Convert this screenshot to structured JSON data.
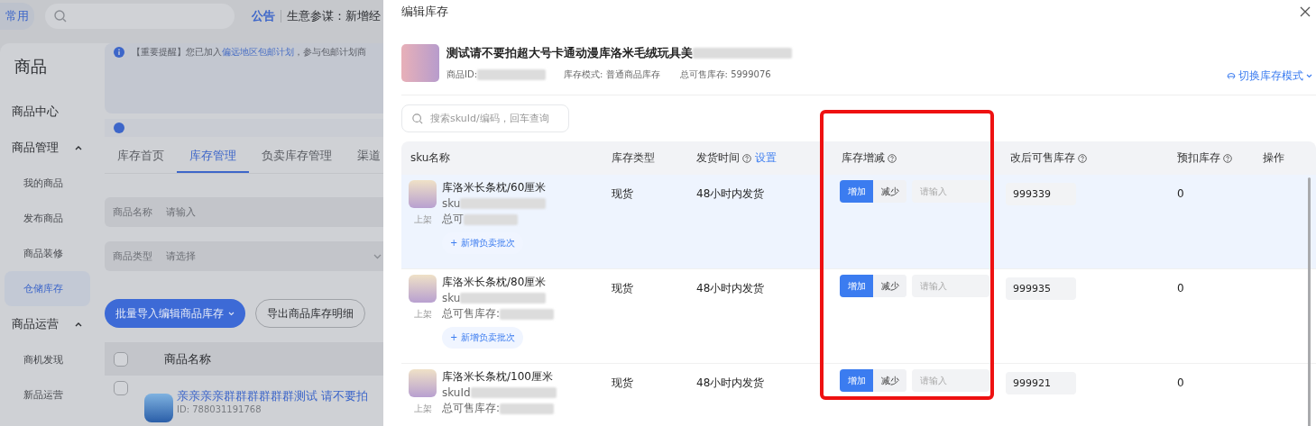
{
  "top_bar": {
    "shortcut": "常用",
    "notice_label": "公告",
    "notice_text": "生意参谋：新增经"
  },
  "sidebar": {
    "title": "商品",
    "items": [
      {
        "label": "商品中心",
        "kind": "link",
        "selected": false
      },
      {
        "label": "商品管理",
        "kind": "group",
        "expanded": true,
        "children": [
          {
            "label": "我的商品",
            "selected": false
          },
          {
            "label": "发布商品",
            "selected": false
          },
          {
            "label": "商品装修",
            "selected": false
          },
          {
            "label": "仓储库存",
            "selected": true
          }
        ]
      },
      {
        "label": "商品运营",
        "kind": "group",
        "expanded": true,
        "children": [
          {
            "label": "商机发现",
            "selected": false
          },
          {
            "label": "新品运营",
            "selected": false
          }
        ]
      }
    ]
  },
  "notices": [
    {
      "prefix": "【重要提醒】您已加入",
      "link": "偏远地区包邮计划",
      "suffix": "，参与包邮计划商"
    }
  ],
  "tabs": [
    {
      "label": "库存首页",
      "selected": false
    },
    {
      "label": "库存管理",
      "selected": true
    },
    {
      "label": "负卖库存管理",
      "selected": false
    },
    {
      "label": "渠道",
      "selected": false
    }
  ],
  "filters": [
    {
      "label": "商品名称",
      "placeholder": "请输入",
      "kind": "input"
    },
    {
      "label": "商品类型",
      "placeholder": "请选择",
      "kind": "select"
    }
  ],
  "actions": [
    {
      "label": "批量导入编辑商品库存",
      "kind": "primary"
    },
    {
      "label": "导出商品库存明细",
      "kind": "secondary"
    }
  ],
  "product_table": {
    "select_all": {
      "checked": false
    },
    "columns": [
      "商品名称"
    ],
    "rows": [
      {
        "checked": false,
        "name": "亲亲亲亲群群群群群群测试 请不要拍",
        "id": "ID: 788031191768"
      }
    ]
  },
  "drawer": {
    "title": "编辑库存",
    "product": {
      "name": "测试请不要拍超大号卡通动漫库洛米毛绒玩具美",
      "id_label": "商品ID:",
      "stock_mode": "库存模式: 普通商品库存",
      "total_stock": "总可售库存: 5999076"
    },
    "switch_mode": "切换库存模式",
    "search": {
      "placeholder": "搜索skuId/编码，回车查询"
    },
    "columns": [
      {
        "label": "sku名称",
        "help": false
      },
      {
        "label": "库存类型",
        "help": false
      },
      {
        "label": "发货时间",
        "help": true,
        "link": "设置"
      },
      {
        "label": "库存增减",
        "help": true
      },
      {
        "label": "改后可售库存",
        "help": true
      },
      {
        "label": "预扣库存",
        "help": true
      },
      {
        "label": "操作",
        "help": false
      }
    ],
    "rows": [
      {
        "name": "库洛米长条枕/60厘米",
        "status": "上架",
        "sku": "sku",
        "stock": "总可",
        "add_batch": "+ 新增负卖批次",
        "type": "现货",
        "ship": "48小时内发货",
        "adjust": [
          {
            "label": "增加",
            "selected": true
          },
          {
            "label": "减少",
            "selected": false
          }
        ],
        "amount_placeholder": "请输入",
        "new_stock": "999339",
        "withheld": "0",
        "highlighted": true
      },
      {
        "name": "库洛米长条枕/80厘米",
        "status": "上架",
        "sku": "sku",
        "stock": "总可售库存:",
        "add_batch": "+ 新增负卖批次",
        "type": "现货",
        "ship": "48小时内发货",
        "adjust": [
          {
            "label": "增加",
            "selected": true
          },
          {
            "label": "减少",
            "selected": false
          }
        ],
        "amount_placeholder": "请输入",
        "new_stock": "999935",
        "withheld": "0",
        "highlighted": false
      },
      {
        "name": "库洛米长条枕/100厘米",
        "status": "上架",
        "sku": "skuId",
        "stock": "总可售库存:",
        "type": "现货",
        "ship": "48小时内发货",
        "adjust": [
          {
            "label": "增加",
            "selected": true
          },
          {
            "label": "减少",
            "selected": false
          }
        ],
        "amount_placeholder": "请输入",
        "new_stock": "999921",
        "withheld": "0",
        "highlighted": false
      }
    ]
  }
}
